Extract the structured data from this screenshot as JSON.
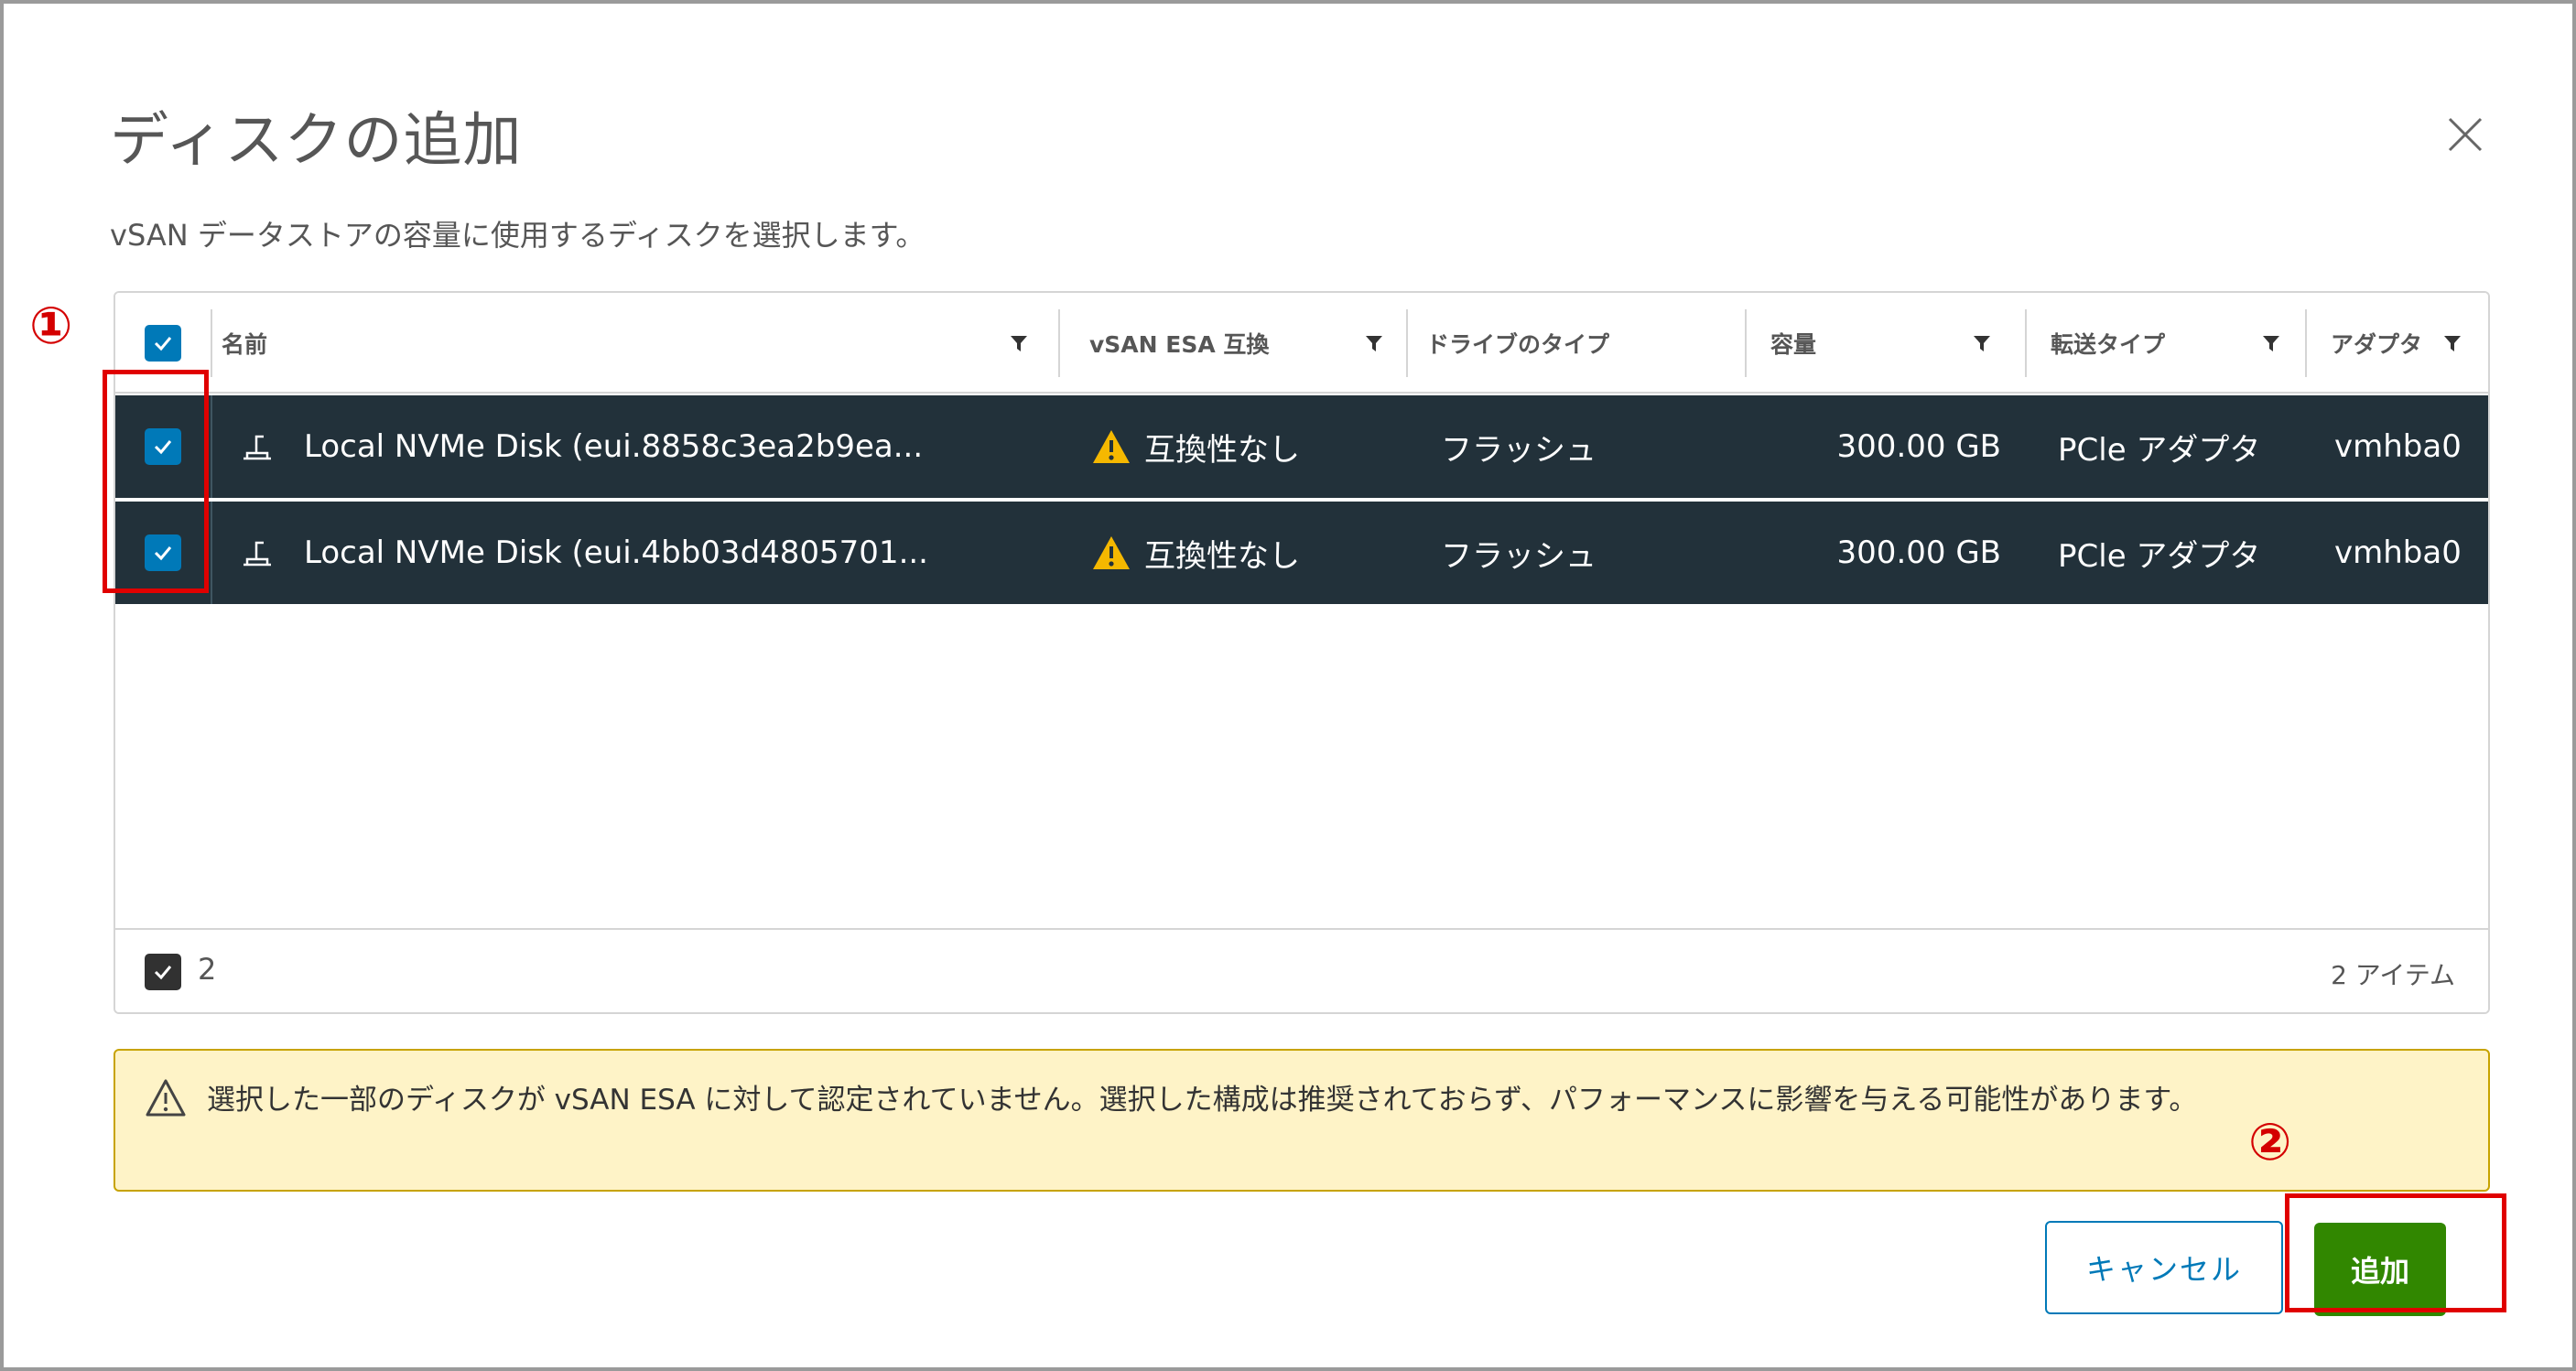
{
  "dialog": {
    "title": "ディスクの追加",
    "subtitle": "vSAN データストアの容量に使用するディスクを選択します。"
  },
  "table": {
    "columns": [
      {
        "label": "名前",
        "filter": true
      },
      {
        "label": "vSAN ESA 互換",
        "filter": true
      },
      {
        "label": "ドライブのタイプ",
        "filter": false
      },
      {
        "label": "容量",
        "filter": true
      },
      {
        "label": "転送タイプ",
        "filter": true
      },
      {
        "label": "アダプタ",
        "filter": true
      }
    ],
    "rows": [
      {
        "name": "Local NVMe Disk (eui.8858c3ea2b9ea...",
        "compat": "互換性なし",
        "drive_type": "フラッシュ",
        "capacity": "300.00 GB",
        "transport": "PCle アダプタ",
        "adapter": "vmhba0",
        "selected": true
      },
      {
        "name": "Local NVMe Disk (eui.4bb03d4805701...",
        "compat": "互換性なし",
        "drive_type": "フラッシュ",
        "capacity": "300.00 GB",
        "transport": "PCle アダプタ",
        "adapter": "vmhba0",
        "selected": true
      }
    ],
    "footer": {
      "selected_count": "2",
      "item_count": "2 アイテム"
    }
  },
  "alert": {
    "message": "選択した一部のディスクが vSAN ESA に対して認定されていません。選択した構成は推奨されておらず、パフォーマンスに影響を与える可能性があります。"
  },
  "buttons": {
    "cancel": "キャンセル",
    "add": "追加"
  },
  "annotations": {
    "marker1": "①",
    "marker2": "②"
  },
  "colors": {
    "row_selected_bg": "#22313a",
    "checkbox": "#0079b8",
    "add_button": "#318700",
    "cancel_border": "#0079b8",
    "warning_bg": "#fef3c7",
    "warning_icon": "#f5b800",
    "annotation": "#e00000"
  },
  "icons": {
    "close": "close-icon",
    "filter": "filter-icon",
    "disk": "disk-icon",
    "warning": "warning-icon",
    "check": "check-icon"
  }
}
